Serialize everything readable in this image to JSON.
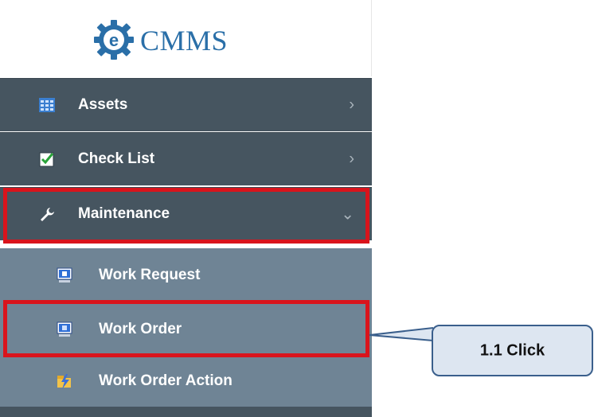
{
  "logo": {
    "text": "CMMS",
    "mark": "e"
  },
  "nav": {
    "assets": {
      "label": "Assets",
      "icon": "grid-table-icon",
      "chevron": "›"
    },
    "checklist": {
      "label": "Check List",
      "icon": "checkbox-icon",
      "chevron": "›"
    },
    "maintenance": {
      "label": "Maintenance",
      "icon": "wrench-icon",
      "chevron": "⌄"
    },
    "sub": [
      {
        "label": "Work Request",
        "icon": "monitor-icon"
      },
      {
        "label": "Work Order",
        "icon": "monitor-icon"
      },
      {
        "label": "Work Order Action",
        "icon": "lightning-folder-icon"
      }
    ]
  },
  "callout": {
    "text": "1.1 Click"
  },
  "colors": {
    "top_item": "#465560",
    "sub_item": "#6f8495",
    "highlight": "#d9141c",
    "callout_fill": "#dde6f1",
    "brand": "#2a6fa8"
  }
}
